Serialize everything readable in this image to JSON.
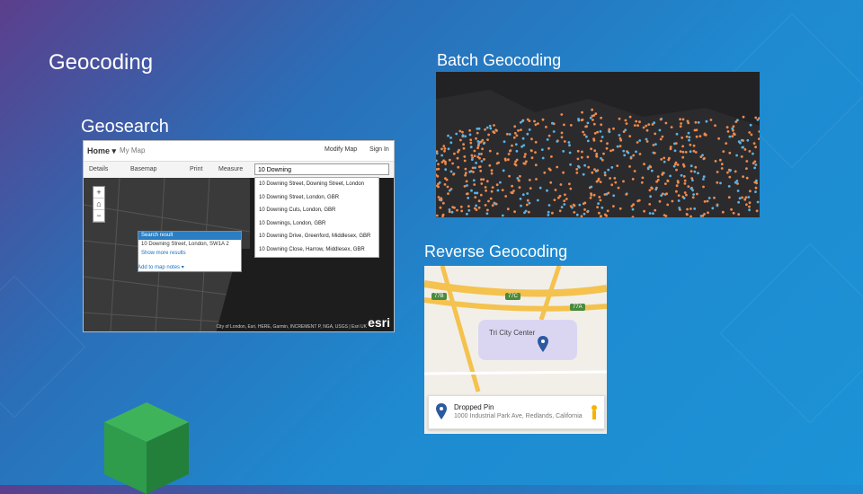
{
  "titles": {
    "geocoding": "Geocoding",
    "batch": "Batch Geocoding",
    "geosearch": "Geosearch",
    "reverse": "Reverse Geocoding"
  },
  "geosearch": {
    "home": "Home ▾",
    "map_title": "My Map",
    "modify_map": "Modify Map",
    "sign_in": "Sign In",
    "details": "Details",
    "basemap": "Basemap",
    "print": "Print",
    "measure": "Measure",
    "search_value": "10 Downing",
    "suggestions": [
      "10 Downing Street, Downing Street, London",
      "10 Downing Street, London, GBR",
      "10 Downing Cuts, London, GBR",
      "10 Downings, London, GBR",
      "10 Downing Drive, Greenford, Middlesex, GBR",
      "10 Downing Close, Harrow, Middlesex, GBR"
    ],
    "popup_title": "Search result",
    "popup_address": "10 Downing Street, London, SW1A 2",
    "popup_more": "Show more results",
    "add_to_map": "Add to map notes ▾",
    "attribution": "City of London, Esri, HERE, Garmin, INCREMENT P, NGA, USGS | Esri UK",
    "esri": "esri"
  },
  "reverse": {
    "label": "Tri City Center",
    "pin_name": "Dropped Pin",
    "pin_address": "1000 Industrial Park Ave, Redlands, California",
    "shields": [
      "77B",
      "77C",
      "77A"
    ]
  },
  "colors": {
    "accent": "#1c93d6",
    "cube": "#2e9c4a",
    "points_orange": "#f08a4b",
    "points_blue": "#5ab4e6"
  }
}
